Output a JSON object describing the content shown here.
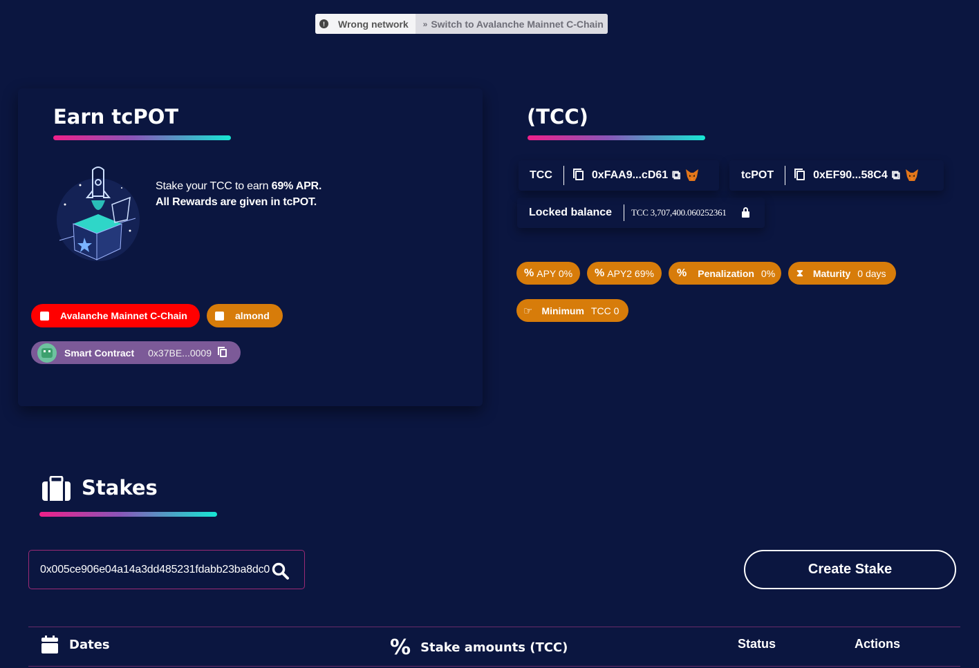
{
  "network_banner": {
    "warning": "Wrong network",
    "switch_label": "Switch to Avalanche Mainnet C-Chain"
  },
  "earn": {
    "title": "Earn tcPOT",
    "desc_line1_prefix": "Stake your TCC to earn ",
    "desc_line1_apr": "69% APR.",
    "desc_line2": "All Rewards are given in tcPOT.",
    "network_tag": "Avalanche Mainnet C-Chain",
    "almond_tag": "almond",
    "contract_label": "Smart Contract",
    "contract_address": "0x37BE...0009"
  },
  "token_panel": {
    "title": "(TCC)",
    "tokens": [
      {
        "symbol": "TCC",
        "address": "0xFAA9...cD61"
      },
      {
        "symbol": "tcPOT",
        "address": "0xEF90...58C4"
      }
    ],
    "locked_label": "Locked balance",
    "locked_value": "TCC 3,707,400.060252361"
  },
  "badges": {
    "apy": "APY 0%",
    "apy2": "APY2 69%",
    "penalization_label": "Penalization",
    "penalization_value": "0%",
    "maturity_label": "Maturity",
    "maturity_value": "0 days",
    "minimum_label": "Minimum",
    "minimum_value": "TCC 0"
  },
  "stakes": {
    "title": "Stakes",
    "search_value": "0x005ce906e04a14a3dd485231fdabb23ba8dc0",
    "create_label": "Create Stake",
    "columns": [
      "Dates",
      "Stake amounts (TCC)",
      "Status",
      "Actions"
    ]
  },
  "colors": {
    "background": "#0b1640",
    "accent_orange": "#d77c0a",
    "network_red": "#ff0000",
    "contract_purple": "#7c5a98",
    "gradient_start": "#f0208a",
    "gradient_end": "#16e7d3"
  }
}
